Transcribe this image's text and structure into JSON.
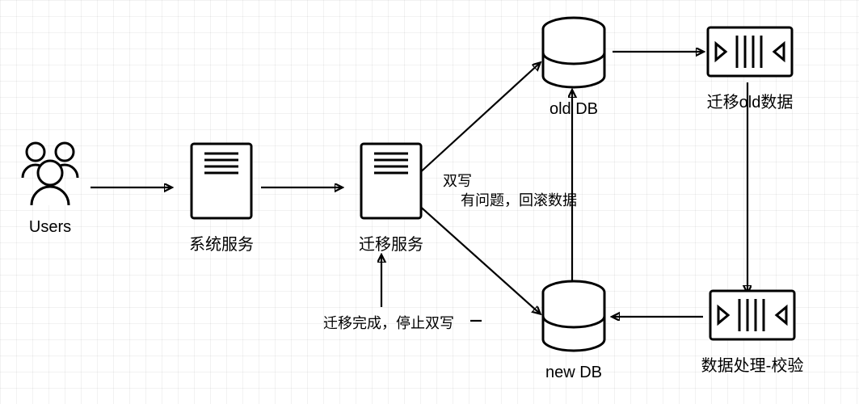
{
  "diagram": {
    "nodes": {
      "users": {
        "label": "Users"
      },
      "system_service": {
        "label": "系统服务"
      },
      "migration_service": {
        "label": "迁移服务"
      },
      "old_db": {
        "label": "old  DB"
      },
      "new_db": {
        "label": "new DB"
      },
      "migrate_old_data": {
        "label": "迁移old数据"
      },
      "data_process_verify": {
        "label": "数据处理-校验"
      }
    },
    "edge_labels": {
      "dual_write": "双写",
      "rollback": "有问题，回滚数据",
      "stop_dual_write": "迁移完成，停止双写"
    }
  }
}
